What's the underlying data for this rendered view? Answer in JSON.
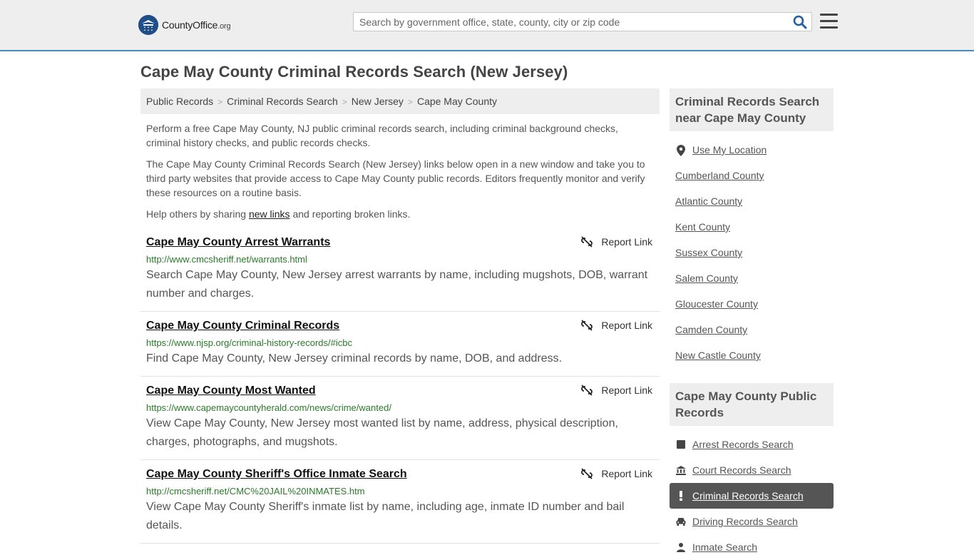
{
  "header": {
    "logo_text": "CountyOffice",
    "logo_suffix": ".org",
    "search_placeholder": "Search by government office, state, county, city or zip code"
  },
  "page_title": "Cape May County Criminal Records Search (New Jersey)",
  "breadcrumb": [
    "Public Records",
    "Criminal Records Search",
    "New Jersey",
    "Cape May County"
  ],
  "intro": {
    "p1": "Perform a free Cape May County, NJ public criminal records search, including criminal background checks, criminal history checks, and public records checks.",
    "p2": "The Cape May County Criminal Records Search (New Jersey) links below open in a new window and take you to third party websites that provide access to Cape May County public records. Editors frequently monitor and verify these resources on a routine basis.",
    "p3_before": "Help others by sharing ",
    "p3_link": "new links",
    "p3_after": " and reporting broken links."
  },
  "report_label": "Report Link",
  "listings": [
    {
      "title": "Cape May County Arrest Warrants",
      "url": "http://www.cmcsheriff.net/warrants.html",
      "desc": "Search Cape May County, New Jersey arrest warrants by name, including mugshots, DOB, warrant number and charges."
    },
    {
      "title": "Cape May County Criminal Records",
      "url": "https://www.njsp.org/criminal-history-records/#icbc",
      "desc": "Find Cape May County, New Jersey criminal records by name, DOB, and address."
    },
    {
      "title": "Cape May County Most Wanted",
      "url": "https://www.capemaycountyherald.com/news/crime/wanted/",
      "desc": "View Cape May County, New Jersey most wanted list by name, address, physical description, charges, photographs, and mugshots."
    },
    {
      "title": "Cape May County Sheriff's Office Inmate Search",
      "url": "http://cmcsheriff.net/CMC%20JAIL%20INMATES.htm",
      "desc": "View Cape May County Sheriff's inmate list by name, including age, inmate ID number and bail details."
    }
  ],
  "sidebar": {
    "nearby_heading": "Criminal Records Search near Cape May County",
    "use_location": "Use My Location",
    "nearby": [
      "Cumberland County",
      "Atlantic County",
      "Kent County",
      "Sussex County",
      "Salem County",
      "Gloucester County",
      "Camden County",
      "New Castle County"
    ],
    "public_heading": "Cape May County Public Records",
    "public_items": [
      {
        "label": "Arrest Records Search",
        "icon": "square-icon"
      },
      {
        "label": "Court Records Search",
        "icon": "courthouse-icon"
      },
      {
        "label": "Criminal Records Search",
        "icon": "exclamation-icon",
        "active": true
      },
      {
        "label": "Driving Records Search",
        "icon": "car-icon"
      },
      {
        "label": "Inmate Search",
        "icon": "inmate-icon"
      }
    ]
  },
  "colors": {
    "header_bg": "#eeeeee",
    "header_border": "#4a8bc4",
    "link_green": "#2a7a2a",
    "active_bg": "#555555"
  }
}
